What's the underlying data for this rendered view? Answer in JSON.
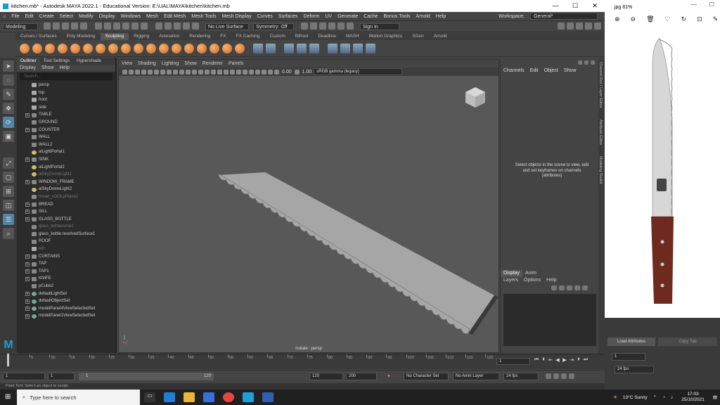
{
  "window": {
    "title": "kitchen.mb* - Autodesk MAYA 2022.1 - Educational Version: E:\\UAL\\MAYA\\kitchen\\kitchen.mb"
  },
  "menubar": {
    "items": [
      "File",
      "Edit",
      "Create",
      "Select",
      "Modify",
      "Display",
      "Windows",
      "Mesh",
      "Edit Mesh",
      "Mesh Tools",
      "Mesh Display",
      "Curves",
      "Surfaces",
      "Deform",
      "UV",
      "Generate",
      "Cache",
      "Bonus Tools",
      "Arnold",
      "Help"
    ],
    "workspace_label": "Workspace:",
    "workspace_value": "General*"
  },
  "statusline": {
    "mode": "Modeling",
    "live_surface": "No Live Surface",
    "symmetry": "Symmetry: Off",
    "sign_in": "Sign In"
  },
  "shelf": {
    "tabs": [
      "Curves / Surfaces",
      "Poly Modeling",
      "Sculpting",
      "Rigging",
      "Animation",
      "Rendering",
      "FX",
      "FX Caching",
      "Custom",
      "Bifrost",
      "Deadline",
      "MASH",
      "Motion Graphics",
      "XGen",
      "Arnold"
    ],
    "active_tab": "Sculpting"
  },
  "outliner": {
    "tabs": [
      "Outliner",
      "Tool Settings",
      "Hypershade"
    ],
    "menu": [
      "Display",
      "Show",
      "Help"
    ],
    "search_placeholder": "Search...",
    "items": [
      {
        "label": "persp",
        "icon": "cam",
        "exp": false,
        "dim": false
      },
      {
        "label": "top",
        "icon": "cam",
        "exp": false,
        "dim": false
      },
      {
        "label": "front",
        "icon": "cam",
        "exp": false,
        "dim": false
      },
      {
        "label": "side",
        "icon": "cam",
        "exp": false,
        "dim": false
      },
      {
        "label": "TABLE",
        "icon": "mesh",
        "exp": true,
        "dim": false
      },
      {
        "label": "GROUND",
        "icon": "mesh",
        "exp": false,
        "dim": false
      },
      {
        "label": "COUNTER",
        "icon": "mesh",
        "exp": true,
        "dim": false
      },
      {
        "label": "WALL",
        "icon": "mesh",
        "exp": false,
        "dim": false
      },
      {
        "label": "WALL2",
        "icon": "mesh",
        "exp": false,
        "dim": false
      },
      {
        "label": "aiLightPortal1",
        "icon": "light",
        "exp": false,
        "dim": false
      },
      {
        "label": "SINK",
        "icon": "mesh",
        "exp": true,
        "dim": false
      },
      {
        "label": "aiLightPortal2",
        "icon": "light",
        "exp": false,
        "dim": false
      },
      {
        "label": "aiSkyDomeLight1",
        "icon": "light",
        "exp": false,
        "dim": true
      },
      {
        "label": "WINDOW_FRAME",
        "icon": "mesh",
        "exp": true,
        "dim": false
      },
      {
        "label": "aiSkyDomeLight2",
        "icon": "light",
        "exp": false,
        "dim": false
      },
      {
        "label": "bread_sOOLpPlane1",
        "icon": "mesh",
        "exp": false,
        "dim": true
      },
      {
        "label": "BREAD",
        "icon": "mesh",
        "exp": true,
        "dim": false
      },
      {
        "label": "SILL",
        "icon": "mesh",
        "exp": true,
        "dim": false
      },
      {
        "label": "GLASS_BOTTLE",
        "icon": "mesh",
        "exp": true,
        "dim": false
      },
      {
        "label": "glass_bottlecurve1",
        "icon": "mesh",
        "exp": false,
        "dim": true
      },
      {
        "label": "glass_bottle:revolvedSurface1",
        "icon": "mesh",
        "exp": false,
        "dim": false
      },
      {
        "label": "ROOF",
        "icon": "mesh",
        "exp": false,
        "dim": false
      },
      {
        "label": "left",
        "icon": "cam",
        "exp": false,
        "dim": true
      },
      {
        "label": "CURTAINS",
        "icon": "mesh",
        "exp": true,
        "dim": false
      },
      {
        "label": "TAP",
        "icon": "mesh",
        "exp": true,
        "dim": false
      },
      {
        "label": "TAP1",
        "icon": "mesh",
        "exp": true,
        "dim": false
      },
      {
        "label": "KNIFE",
        "icon": "mesh",
        "exp": true,
        "dim": false
      },
      {
        "label": "pCube2",
        "icon": "mesh",
        "exp": false,
        "dim": false
      },
      {
        "label": "defaultLightSet",
        "icon": "set",
        "exp": true,
        "dim": false
      },
      {
        "label": "defaultObjectSet",
        "icon": "set",
        "exp": true,
        "dim": false
      },
      {
        "label": "modelPanel4ViewSelectedSet",
        "icon": "set",
        "exp": true,
        "dim": false
      },
      {
        "label": "modelPanel1ViewSelectedSet",
        "icon": "set",
        "exp": true,
        "dim": false
      }
    ]
  },
  "viewport": {
    "menu": [
      "View",
      "Shading",
      "Lighting",
      "Show",
      "Renderer",
      "Panels"
    ],
    "exposure": "0.00",
    "gamma": "1.00",
    "colorspace": "sRGB gamma (legacy)",
    "isolate_label": "Isolate : persp"
  },
  "channelbox": {
    "menu": [
      "Channels",
      "Edit",
      "Object",
      "Show"
    ],
    "hint": "Select objects in the scene to view, edit and set keyframes on channels (attributes)",
    "side_tabs": [
      "Channel Box / Layer Editor",
      "Attribute Editor",
      "Modeling Toolkit"
    ]
  },
  "layers": {
    "tabs": [
      "Display",
      "Anim"
    ],
    "menu": [
      "Layers",
      "Options",
      "Help"
    ]
  },
  "timeline": {
    "ticks": [
      "5",
      "10",
      "15",
      "20",
      "25",
      "30",
      "35",
      "40",
      "45",
      "50",
      "55",
      "60",
      "65",
      "70",
      "75",
      "80",
      "85",
      "90",
      "95",
      "100",
      "105",
      "110",
      "115",
      "120"
    ],
    "current_frame": "1"
  },
  "range": {
    "start": "1",
    "playback_start": "1",
    "slider_start": "1",
    "slider_end": "120",
    "playback_end": "120",
    "end": "200",
    "character_set": "No Character Set",
    "anim_layer": "No Anim Layer",
    "fps": "24 fps"
  },
  "cmdline": {
    "text": "Paint Tool: Select an object to sculpt."
  },
  "photos": {
    "title": ".jpg  81%"
  },
  "maya_right": {
    "load_attributes": "Load Attributes",
    "copy_tab": "Copy Tab",
    "frame": "1",
    "fps": "24 fps"
  },
  "taskbar": {
    "search_placeholder": "Type here to search",
    "weather": "13°C  Sunny",
    "time": "17:03",
    "date": "25/10/2021"
  }
}
